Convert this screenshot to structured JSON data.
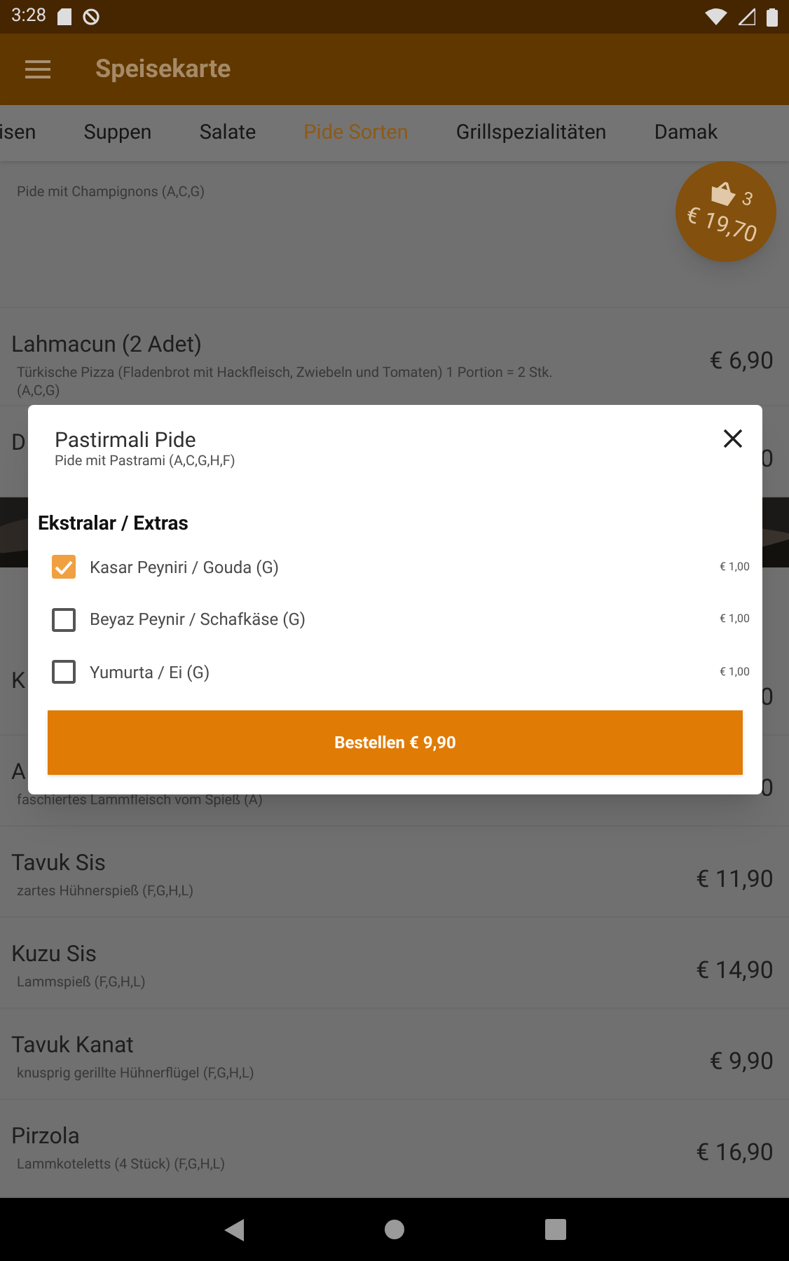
{
  "status_bar": {
    "time": "3:28"
  },
  "app_bar": {
    "title": "Speisekarte"
  },
  "tabs": [
    {
      "label": "isen",
      "selected": false
    },
    {
      "label": "Suppen",
      "selected": false
    },
    {
      "label": "Salate",
      "selected": false
    },
    {
      "label": "Pide Sorten",
      "selected": true
    },
    {
      "label": "Grillspezialitäten",
      "selected": false
    },
    {
      "label": "Damak",
      "selected": false
    }
  ],
  "cart": {
    "count": "3",
    "total": "€ 19,70"
  },
  "menu_items": [
    {
      "kind": "item",
      "description": "Pide mit Champignons (A,C,G)"
    },
    {
      "kind": "item",
      "name": "Lahmacun (2 Adet)",
      "description": "Türkische Pizza (Fladenbrot mit Hackfleisch, Zwiebeln und Tomaten) 1 Portion = 2 Stk. (A,C,G)",
      "price": "€ 6,90"
    },
    {
      "kind": "item",
      "name": "D",
      "price": "0"
    },
    {
      "kind": "picture"
    },
    {
      "kind": "item",
      "name": "K",
      "price": "0"
    },
    {
      "kind": "item",
      "name": "A",
      "description": "faschiertes Lammfleisch vom Spieß (A)",
      "price": "0"
    },
    {
      "kind": "item",
      "name": "Tavuk Sis",
      "description": "zartes Hühnerspieß (F,G,H,L)",
      "price": "€ 11,90"
    },
    {
      "kind": "item",
      "name": "Kuzu Sis",
      "description": "Lammspieß (F,G,H,L)",
      "price": "€ 14,90"
    },
    {
      "kind": "item",
      "name": "Tavuk Kanat",
      "description": "knusprig gerillte Hühnerflügel (F,G,H,L)",
      "price": "€ 9,90"
    },
    {
      "kind": "item",
      "name": "Pirzola",
      "description": "Lammkoteletts (4 Stück) (F,G,H,L)",
      "price": "€ 16,90"
    }
  ],
  "dialog": {
    "title": "Pastirmali Pide",
    "subtitle": "Pide mit Pastrami (A,C,G,H,F)",
    "section": "Ekstralar / Extras",
    "options": [
      {
        "label": "Kasar Peyniri / Gouda (G)",
        "price": "€ 1,00",
        "checked": true
      },
      {
        "label": "Beyaz Peynir / Schafkäse (G)",
        "price": "€ 1,00",
        "checked": false
      },
      {
        "label": "Yumurta / Ei (G)",
        "price": "€ 1,00",
        "checked": false
      }
    ],
    "order_button": "Bestellen € 9,90"
  }
}
